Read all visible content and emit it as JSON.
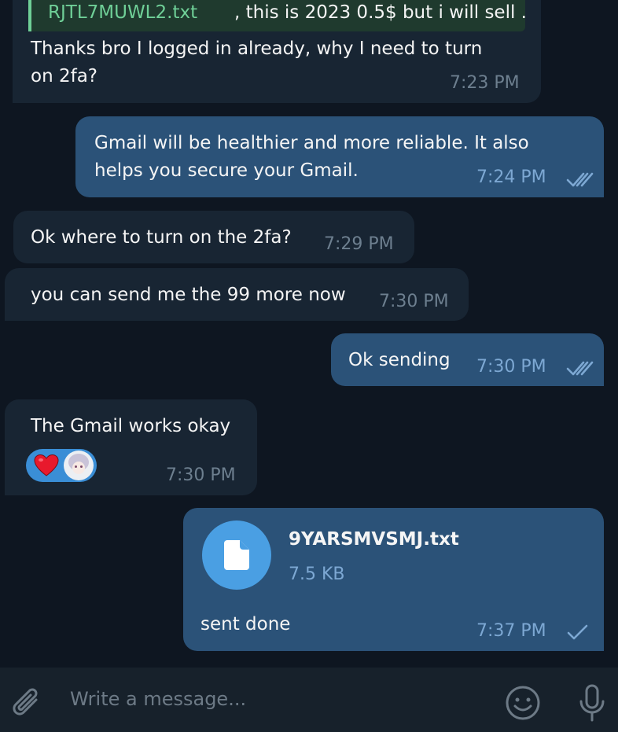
{
  "messages": [
    {
      "id": "m1",
      "side": "in",
      "reply": {
        "name": "RJTL7MUWL2.txt",
        "rest": ", this is 2023 0.5$ but i will sell ..."
      },
      "lines": [
        "Thanks bro I logged in already, why I need to turn",
        "on 2fa?"
      ],
      "time": "7:23 PM"
    },
    {
      "id": "m2",
      "side": "out",
      "lines": [
        "Gmail will be healthier and more reliable. It also",
        "helps you secure your Gmail."
      ],
      "time": "7:24 PM",
      "status": "read"
    },
    {
      "id": "m3",
      "side": "in",
      "lines": [
        "Ok where to turn on the 2fa?"
      ],
      "time": "7:29 PM"
    },
    {
      "id": "m4",
      "side": "in",
      "lines": [
        "you can send me the 99 more now"
      ],
      "time": "7:30 PM"
    },
    {
      "id": "m5",
      "side": "out",
      "lines": [
        "Ok sending"
      ],
      "time": "7:30 PM",
      "status": "read"
    },
    {
      "id": "m6",
      "side": "in",
      "lines": [
        "The Gmail works okay"
      ],
      "time": "7:30 PM",
      "reaction": {
        "emoji": "heart-icon",
        "count_shown_as": "avatar"
      }
    },
    {
      "id": "m7",
      "side": "out",
      "file": {
        "name": "9YARSMVSMJ.txt",
        "size": "7.5 KB",
        "icon": "file-icon"
      },
      "caption": "sent done",
      "time": "7:37 PM",
      "status": "sent"
    }
  ],
  "composer": {
    "placeholder": "Write a message...",
    "attach_icon": "paperclip-icon",
    "emoji_icon": "smile-icon",
    "voice_icon": "microphone-icon"
  },
  "colors": {
    "background": "#0e1621",
    "incoming_bubble": "#182533",
    "outgoing_bubble": "#2b5278",
    "reply_accent": "#6fcf97",
    "file_icon_bg": "#4a9fe3"
  }
}
